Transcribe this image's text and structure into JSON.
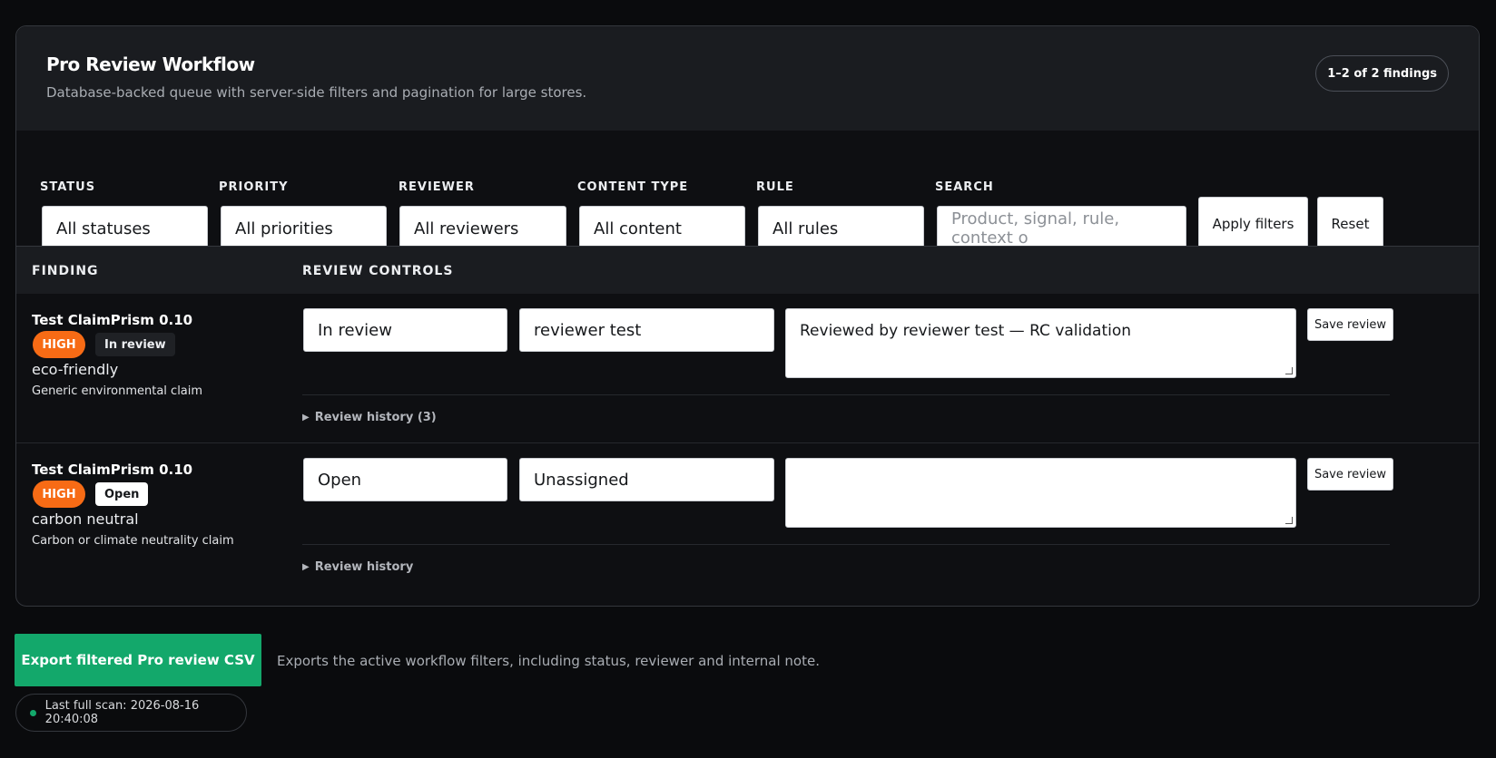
{
  "header": {
    "title": "Pro Review Workflow",
    "subtitle": "Database-backed queue with server-side filters and pagination for large stores.",
    "count": "1–2 of 2 findings"
  },
  "filters": {
    "status": {
      "label": "STATUS",
      "value": "All statuses"
    },
    "priority": {
      "label": "PRIORITY",
      "value": "All priorities"
    },
    "reviewer": {
      "label": "REVIEWER",
      "value": "All reviewers"
    },
    "content_type": {
      "label": "CONTENT TYPE",
      "value": "All content"
    },
    "rule": {
      "label": "RULE",
      "value": "All rules"
    },
    "search": {
      "label": "SEARCH",
      "placeholder": "Product, signal, rule, context o"
    },
    "apply_label": "Apply filters",
    "reset_label": "Reset"
  },
  "table": {
    "col_finding": "FINDING",
    "col_controls": "REVIEW CONTROLS",
    "rows": [
      {
        "title": "Test ClaimPrism 0.10",
        "priority": "HIGH",
        "status_badge": "In review",
        "signal": "eco-friendly",
        "description": "Generic environmental claim",
        "status_select": "In review",
        "reviewer_select": "reviewer test",
        "note": "Reviewed by reviewer test — RC validation",
        "save_label": "Save review",
        "history": "Review history (3)"
      },
      {
        "title": "Test ClaimPrism 0.10",
        "priority": "HIGH",
        "status_badge": "Open",
        "signal": "carbon neutral",
        "description": "Carbon or climate neutrality claim",
        "status_select": "Open",
        "reviewer_select": "Unassigned",
        "note": "",
        "save_label": "Save review",
        "history": "Review history"
      }
    ]
  },
  "footer": {
    "export_label": "Export filtered Pro review CSV",
    "export_note": "Exports the active workflow filters, including status, reviewer and internal note.",
    "last_scan": "Last full scan: 2026-08-16 20:40:08"
  },
  "colors": {
    "accent_green": "#13a86b",
    "priority_high": "#f76b15",
    "background": "#0a0b0d"
  }
}
